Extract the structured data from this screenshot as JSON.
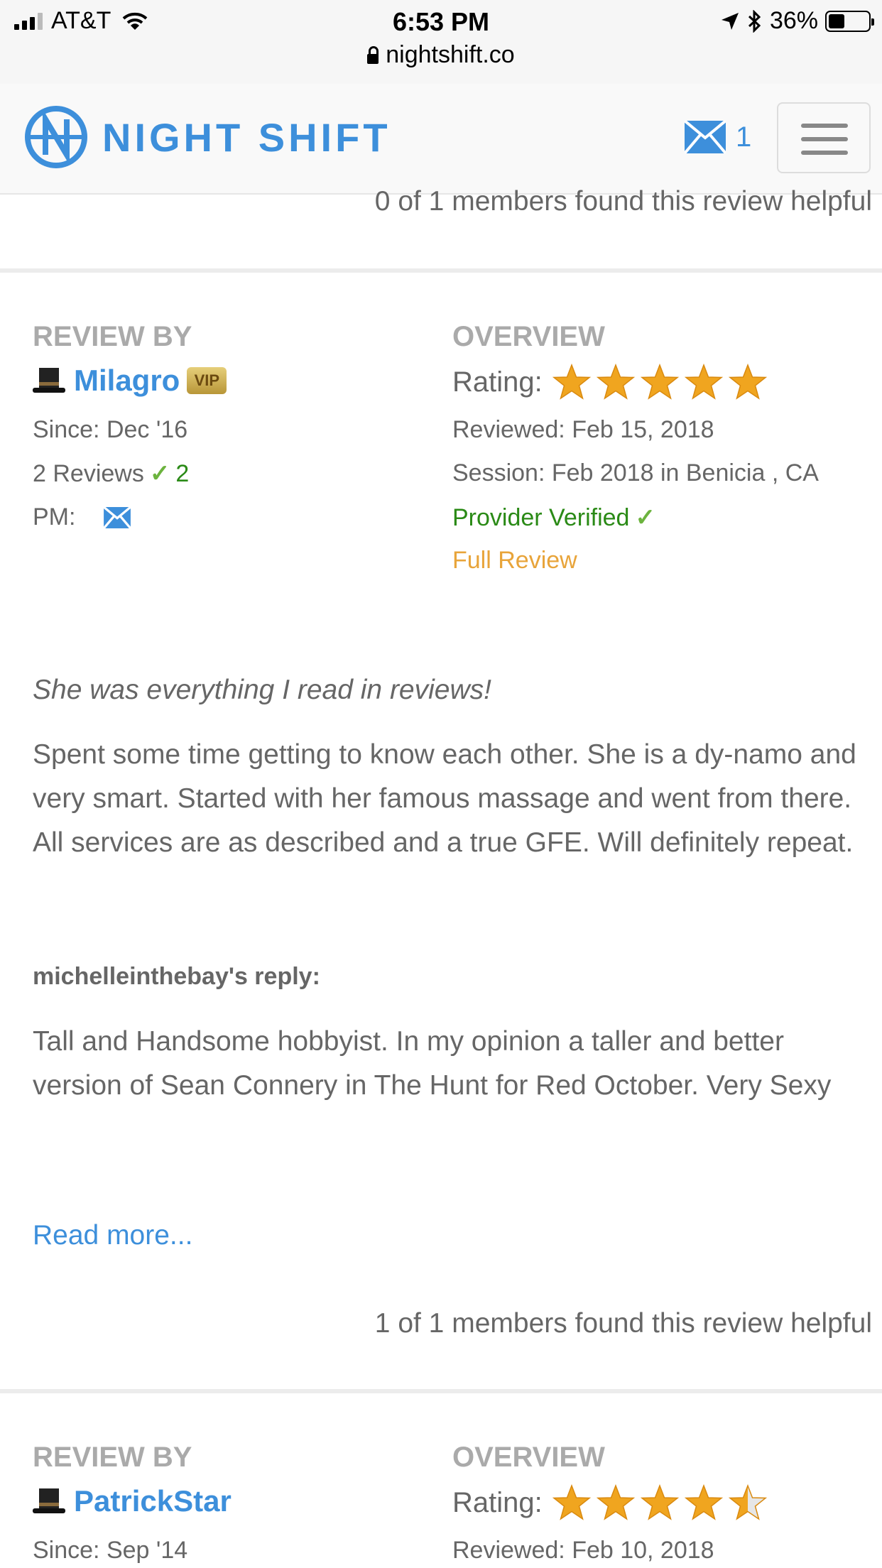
{
  "status": {
    "carrier": "AT&T",
    "time": "6:53 PM",
    "battery": "36%",
    "url": "nightshift.co"
  },
  "header": {
    "logo_text": "NIGHT SHIFT",
    "messages_count": "1"
  },
  "top_helpful": "0 of 1 members found this review helpful",
  "reviews": [
    {
      "review_by_label": "REVIEW BY",
      "username": "Milagro",
      "vip_badge": "VIP",
      "since": "Since: Dec '16",
      "reviews_count": "2 Reviews",
      "verified_count": "2",
      "pm_label": "PM:",
      "overview_label": "OVERVIEW",
      "rating_label": "Rating:",
      "rating": 5,
      "reviewed": "Reviewed: Feb 15, 2018",
      "session": "Session: Feb 2018 in Benicia , CA",
      "provider_verified": "Provider Verified",
      "full_review": "Full Review",
      "title": "She was everything I read in reviews!",
      "body": "Spent some time getting to know each other. She is a dy-namo and very smart. Started with her famous massage and went from there. All services are as described and a true GFE. Will definitely repeat.",
      "reply_heading": "michelleinthebay's reply:",
      "reply_body": "Tall and Handsome hobbyist. In my opinion a taller and better version of Sean Connery in The Hunt for Red October. Very Sexy",
      "read_more": "Read more...",
      "helpful": "1 of 1 members found this review helpful"
    },
    {
      "review_by_label": "REVIEW BY",
      "username": "PatrickStar",
      "since": "Since: Sep '14",
      "overview_label": "OVERVIEW",
      "rating_label": "Rating:",
      "rating": 4.5,
      "reviewed": "Reviewed: Feb 10, 2018"
    }
  ],
  "colors": {
    "brand_blue": "#3d8fdb",
    "star_gold": "#f0a51f",
    "verified_green": "#2a8a16",
    "full_review_orange": "#e8a43a"
  }
}
